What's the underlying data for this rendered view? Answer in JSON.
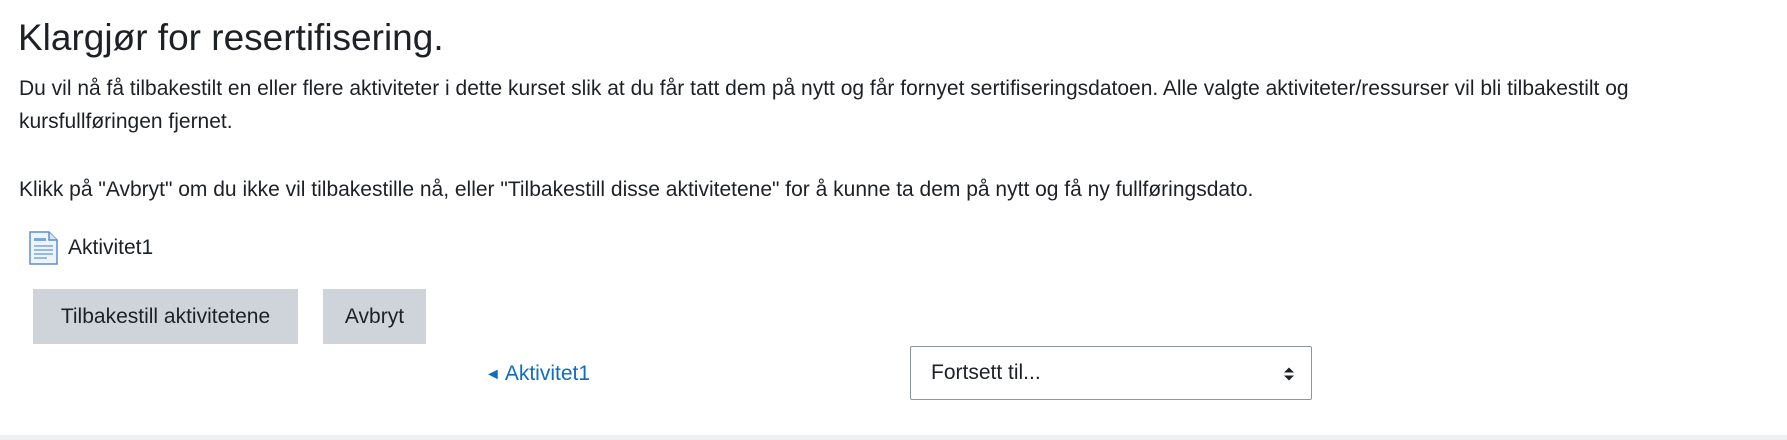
{
  "page": {
    "title": "Klargjør for resertifisering.",
    "intro": "Du vil nå få tilbakestilt en eller flere aktiviteter i dette kurset slik at du får tatt dem på nytt og får fornyet sertifiseringsdatoen. Alle valgte aktiviteter/ressurser vil bli tilbakestilt og kursfullføringen fjernet.",
    "instructions": "Klikk på \"Avbryt\" om du ikke vil tilbakestille nå, eller \"Tilbakestill disse aktivitetene\" for å kunne ta dem på nytt og få ny fullføringsdato."
  },
  "activities": [
    {
      "name": "Aktivitet1",
      "icon": "page-document-icon"
    }
  ],
  "buttons": {
    "reset_label": "Tilbakestill aktivitetene",
    "cancel_label": "Avbryt"
  },
  "navigation": {
    "prev_arrow": "◄",
    "prev_link": "Aktivitet1",
    "jump_to": {
      "selected": "Fortsett til...",
      "icon": "select-caret-icon"
    }
  },
  "colors": {
    "text": "#1d2125",
    "link": "#0f6cbf",
    "button_bg": "#ced4da",
    "select_border": "#8f959e"
  }
}
